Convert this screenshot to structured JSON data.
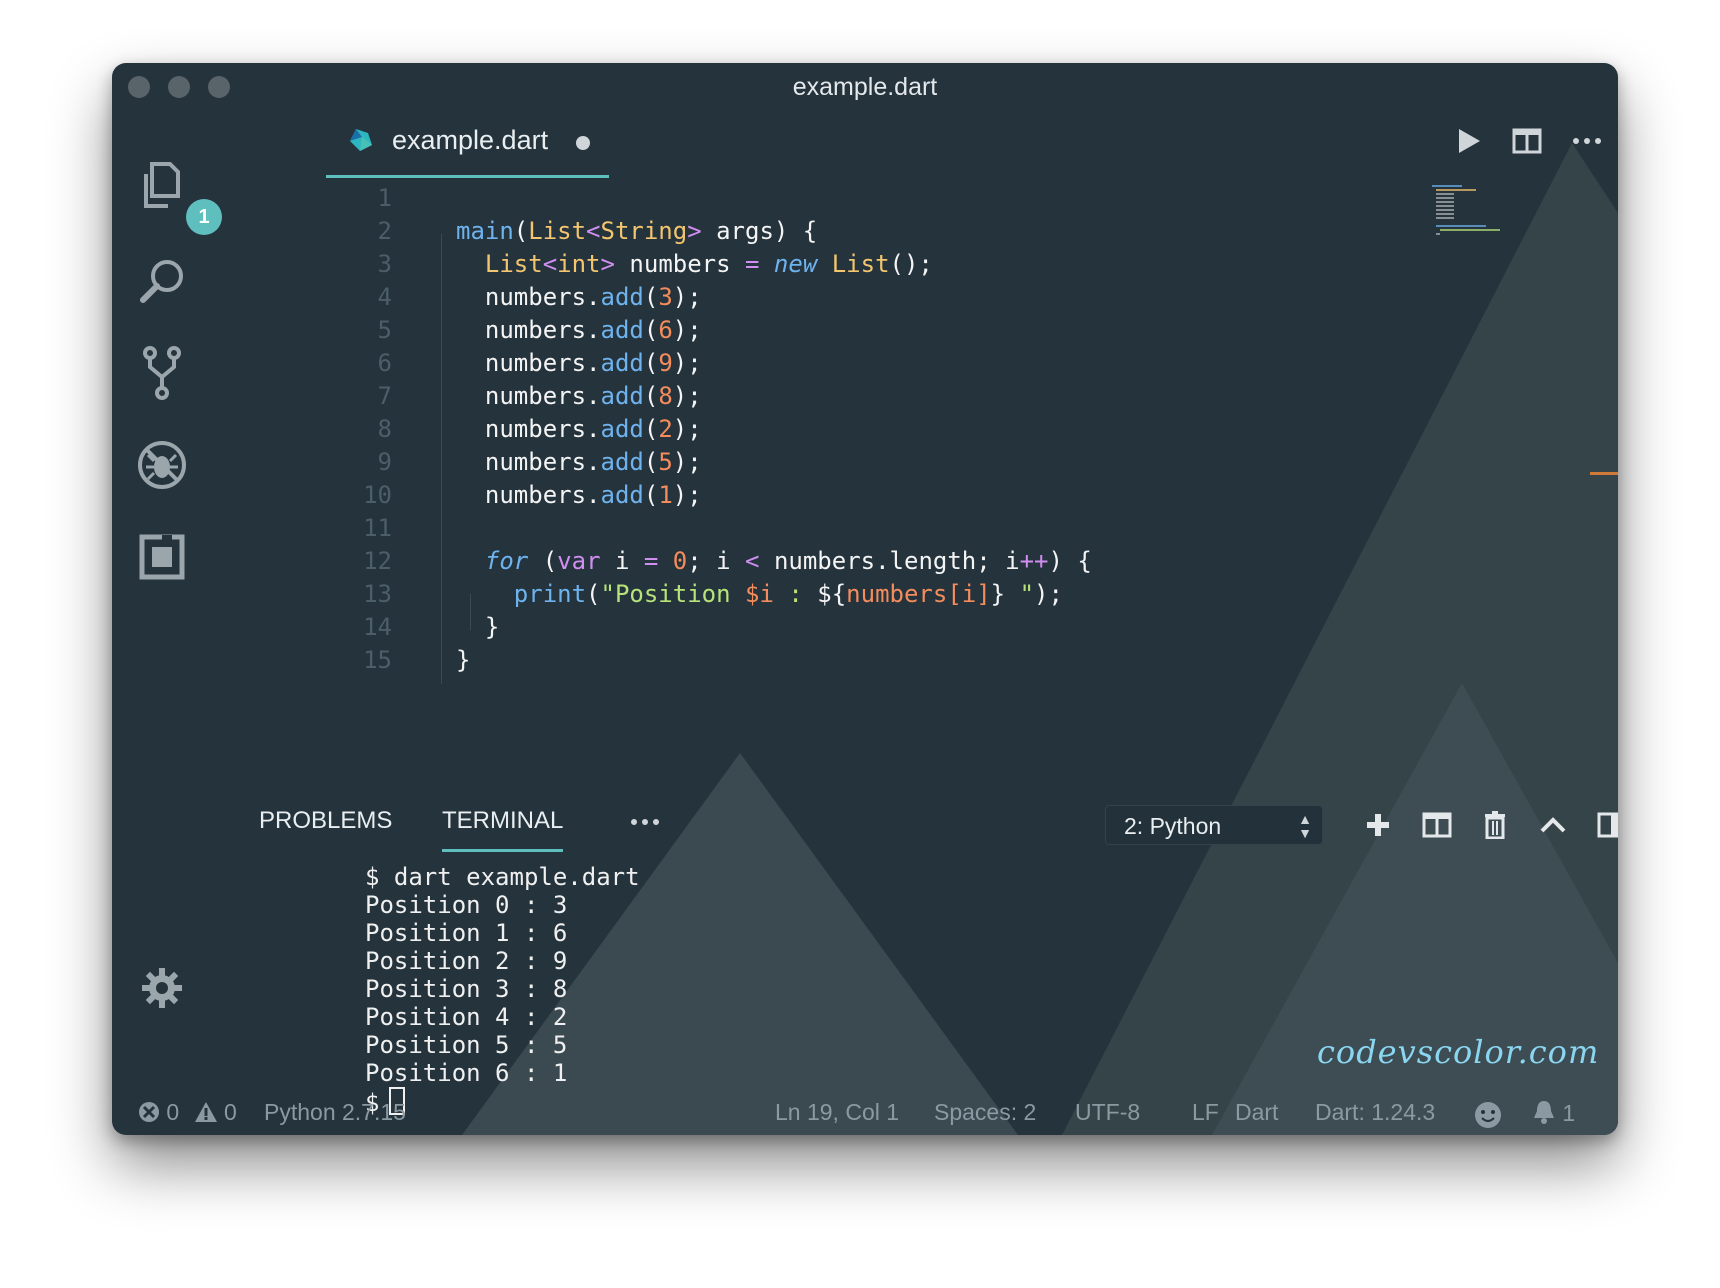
{
  "window": {
    "title": "example.dart"
  },
  "activity": {
    "explorer_badge": "1"
  },
  "tab": {
    "name": "example.dart"
  },
  "editor": {
    "lines": [
      {
        "n": "1",
        "segs": []
      },
      {
        "n": "2",
        "segs": [
          [
            "main",
            "#6fb3ee"
          ],
          [
            "(",
            "#f4f4f4"
          ],
          [
            "List",
            "#f4c56f"
          ],
          [
            "<",
            "#d08ef0"
          ],
          [
            "String",
            "#f4c56f"
          ],
          [
            ">",
            "#d08ef0"
          ],
          [
            " args) {",
            "#f4f4f4"
          ]
        ]
      },
      {
        "n": "3",
        "segs": [
          [
            "  ",
            ""
          ],
          [
            "List",
            "#f4c56f"
          ],
          [
            "<",
            "#d08ef0"
          ],
          [
            "int",
            "#f4c56f"
          ],
          [
            ">",
            "#d08ef0"
          ],
          [
            " numbers ",
            "#f4f4f4"
          ],
          [
            "=",
            "#d08ef0"
          ],
          [
            " ",
            ""
          ],
          [
            "new",
            "#6fb3ee",
            "italic"
          ],
          [
            " ",
            ""
          ],
          [
            "List",
            "#f4c56f"
          ],
          [
            "();",
            "#f4f4f4"
          ]
        ]
      },
      {
        "n": "4",
        "segs": [
          [
            "  numbers",
            "#f4f4f4"
          ],
          [
            ".",
            "#f4f4f4"
          ],
          [
            "add",
            "#6fb3ee"
          ],
          [
            "(",
            "#f4f4f4"
          ],
          [
            "3",
            "#f48c5c"
          ],
          [
            ");",
            "#f4f4f4"
          ]
        ]
      },
      {
        "n": "5",
        "segs": [
          [
            "  numbers",
            "#f4f4f4"
          ],
          [
            ".",
            "#f4f4f4"
          ],
          [
            "add",
            "#6fb3ee"
          ],
          [
            "(",
            "#f4f4f4"
          ],
          [
            "6",
            "#f48c5c"
          ],
          [
            ");",
            "#f4f4f4"
          ]
        ]
      },
      {
        "n": "6",
        "segs": [
          [
            "  numbers",
            "#f4f4f4"
          ],
          [
            ".",
            "#f4f4f4"
          ],
          [
            "add",
            "#6fb3ee"
          ],
          [
            "(",
            "#f4f4f4"
          ],
          [
            "9",
            "#f48c5c"
          ],
          [
            ");",
            "#f4f4f4"
          ]
        ]
      },
      {
        "n": "7",
        "segs": [
          [
            "  numbers",
            "#f4f4f4"
          ],
          [
            ".",
            "#f4f4f4"
          ],
          [
            "add",
            "#6fb3ee"
          ],
          [
            "(",
            "#f4f4f4"
          ],
          [
            "8",
            "#f48c5c"
          ],
          [
            ");",
            "#f4f4f4"
          ]
        ]
      },
      {
        "n": "8",
        "segs": [
          [
            "  numbers",
            "#f4f4f4"
          ],
          [
            ".",
            "#f4f4f4"
          ],
          [
            "add",
            "#6fb3ee"
          ],
          [
            "(",
            "#f4f4f4"
          ],
          [
            "2",
            "#f48c5c"
          ],
          [
            ");",
            "#f4f4f4"
          ]
        ]
      },
      {
        "n": "9",
        "segs": [
          [
            "  numbers",
            "#f4f4f4"
          ],
          [
            ".",
            "#f4f4f4"
          ],
          [
            "add",
            "#6fb3ee"
          ],
          [
            "(",
            "#f4f4f4"
          ],
          [
            "5",
            "#f48c5c"
          ],
          [
            ");",
            "#f4f4f4"
          ]
        ]
      },
      {
        "n": "10",
        "segs": [
          [
            "  numbers",
            "#f4f4f4"
          ],
          [
            ".",
            "#f4f4f4"
          ],
          [
            "add",
            "#6fb3ee"
          ],
          [
            "(",
            "#f4f4f4"
          ],
          [
            "1",
            "#f48c5c"
          ],
          [
            ");",
            "#f4f4f4"
          ]
        ]
      },
      {
        "n": "11",
        "segs": []
      },
      {
        "n": "12",
        "segs": [
          [
            "  ",
            ""
          ],
          [
            "for",
            "#6fb3ee",
            "italic"
          ],
          [
            " (",
            "#f4f4f4"
          ],
          [
            "var",
            "#d08ef0"
          ],
          [
            " i ",
            "#f4f4f4"
          ],
          [
            "=",
            "#d08ef0"
          ],
          [
            " ",
            ""
          ],
          [
            "0",
            "#f48c5c"
          ],
          [
            "; i ",
            "#f4f4f4"
          ],
          [
            "<",
            "#d08ef0"
          ],
          [
            " numbers",
            "#f4f4f4"
          ],
          [
            ".",
            "#f4f4f4"
          ],
          [
            "length; i",
            "#f4f4f4"
          ],
          [
            "++",
            "#d08ef0"
          ],
          [
            ") {",
            "#f4f4f4"
          ]
        ]
      },
      {
        "n": "13",
        "segs": [
          [
            "    ",
            ""
          ],
          [
            "print",
            "#6fb3ee"
          ],
          [
            "(",
            "#f4f4f4"
          ],
          [
            "\"Position ",
            "#b8e27a"
          ],
          [
            "$i",
            "#f48c5c"
          ],
          [
            " : ",
            "#b8e27a"
          ],
          [
            "${",
            "#f4f4f4"
          ],
          [
            "numbers[i]",
            "#f48c5c"
          ],
          [
            "}",
            "#f4f4f4"
          ],
          [
            " \"",
            "#b8e27a"
          ],
          [
            ");",
            "#f4f4f4"
          ]
        ]
      },
      {
        "n": "14",
        "segs": [
          [
            "  }",
            "#f4f4f4"
          ]
        ]
      },
      {
        "n": "15",
        "segs": [
          [
            "}",
            "#f4f4f4"
          ]
        ]
      }
    ]
  },
  "panel": {
    "tabs": [
      "PROBLEMS",
      "TERMINAL"
    ],
    "terminal_select": "2: Python"
  },
  "terminal": {
    "lines": [
      "$ dart example.dart",
      "Position 0 : 3",
      "Position 1 : 6",
      "Position 2 : 9",
      "Position 3 : 8",
      "Position 4 : 2",
      "Position 5 : 5",
      "Position 6 : 1"
    ],
    "prompt": "$"
  },
  "status": {
    "errors": "0",
    "warnings": "0",
    "python": "Python 2.7.15",
    "position": "Ln 19, Col 1",
    "spaces": "Spaces: 2",
    "encoding": "UTF-8",
    "eol": "LF",
    "language": "Dart",
    "sdk": "Dart: 1.24.3",
    "notifications": "1"
  },
  "watermark": "codevscolor.com",
  "colors": {
    "accent": "#5fbfbf",
    "background": "#24333c",
    "keyword": "#6fb3ee",
    "type": "#f4c56f",
    "number": "#f48c5c",
    "string": "#b8e27a"
  }
}
